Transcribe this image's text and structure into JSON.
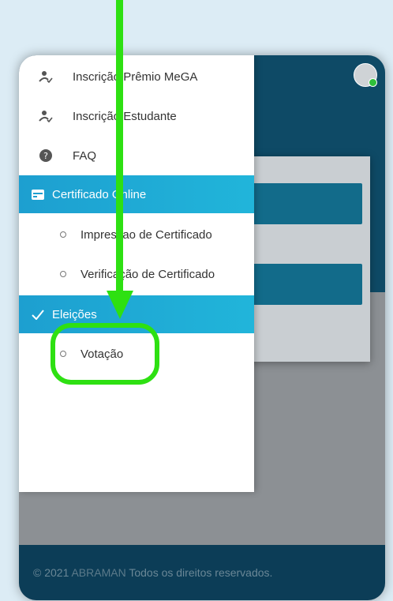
{
  "menu": {
    "items": [
      {
        "label": "Inscrição Prêmio MeGA",
        "icon": "user-check-icon"
      },
      {
        "label": "Inscrição Estudante",
        "icon": "user-check-icon"
      },
      {
        "label": "FAQ",
        "icon": "question-circle-icon"
      }
    ],
    "certificado": {
      "label": "Certificado Online",
      "icon": "certificate-card-icon",
      "sub": [
        {
          "label": "Impressao de Certificado"
        },
        {
          "label": "Verificação de Certificado"
        }
      ]
    },
    "eleicoes": {
      "label": "Eleições",
      "icon": "check-icon",
      "sub": [
        {
          "label": "Votação"
        }
      ]
    }
  },
  "footer": {
    "prefix": "© 2021 ",
    "brand": "ABRAMAN",
    "suffix": " Todos os direitos reservados."
  },
  "colors": {
    "accent": "#21b5da",
    "annotation": "#2ee012",
    "header": "#0e4a66"
  }
}
